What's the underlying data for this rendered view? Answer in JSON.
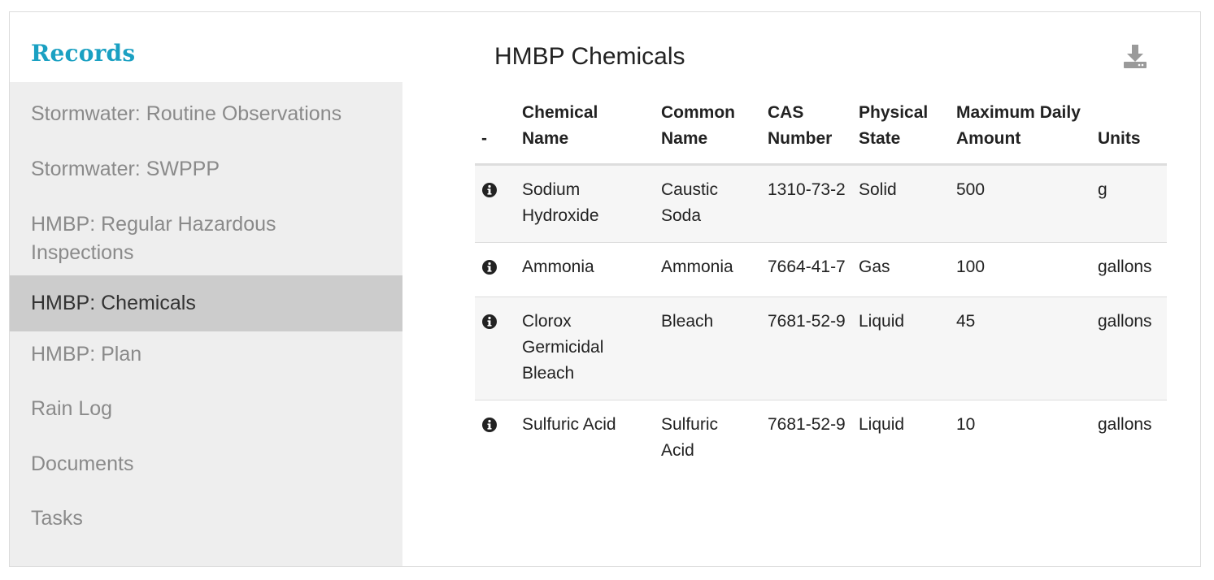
{
  "sidebar": {
    "title": "Records",
    "items": [
      {
        "label": "Stormwater: Routine Observations",
        "active": false
      },
      {
        "label": "Stormwater: SWPPP",
        "active": false
      },
      {
        "label": "HMBP: Regular Hazardous Inspections",
        "active": false
      },
      {
        "label": "HMBP: Chemicals",
        "active": true
      },
      {
        "label": "HMBP: Plan",
        "active": false
      },
      {
        "label": "Rain Log",
        "active": false
      },
      {
        "label": "Documents",
        "active": false
      },
      {
        "label": "Tasks",
        "active": false
      }
    ]
  },
  "main": {
    "title": "HMBP Chemicals",
    "download_icon": "download-icon"
  },
  "table": {
    "headers": {
      "toggle": "-",
      "chemical_name": "Chemical Name",
      "common_name": "Common Name",
      "cas_number": "CAS Number",
      "physical_state": "Physical State",
      "max_daily_amount": "Maximum Daily Amount",
      "units": "Units"
    },
    "rows": [
      {
        "chemical_name": "Sodium Hydroxide",
        "common_name": "Caustic Soda",
        "cas_number": "1310-73-2",
        "physical_state": "Solid",
        "max_daily_amount": "500",
        "units": "g"
      },
      {
        "chemical_name": "Ammonia",
        "common_name": "Ammonia",
        "cas_number": "7664-41-7",
        "physical_state": "Gas",
        "max_daily_amount": "100",
        "units": "gallons"
      },
      {
        "chemical_name": "Clorox Germicidal Bleach",
        "common_name": "Bleach",
        "cas_number": "7681-52-9",
        "physical_state": "Liquid",
        "max_daily_amount": "45",
        "units": "gallons"
      },
      {
        "chemical_name": "Sulfuric Acid",
        "common_name": "Sulfuric Acid",
        "cas_number": "7681-52-9",
        "physical_state": "Liquid",
        "max_daily_amount": "10",
        "units": "gallons"
      }
    ]
  },
  "colors": {
    "accent": "#1aa0c2",
    "nav_bg": "#eeeeee",
    "nav_active_bg": "#cccccc",
    "nav_text": "#8a8a8a"
  }
}
